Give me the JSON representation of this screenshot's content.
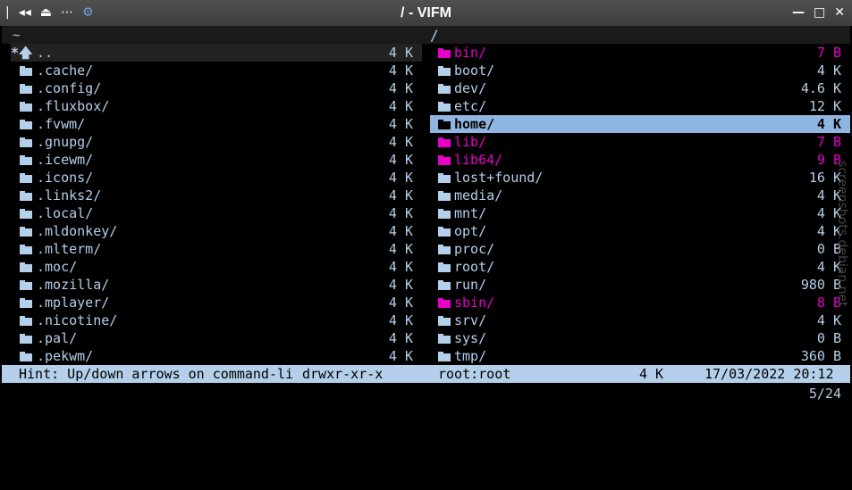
{
  "window": {
    "title": "/ - VIFM",
    "left_icons": [
      "|",
      "◂◂",
      "⏏",
      "⋯",
      "⚙"
    ],
    "controls": {
      "minimize": "—",
      "maximize": "□",
      "close": "✕"
    }
  },
  "paths": {
    "left": "~",
    "right": "/"
  },
  "left_pane": [
    {
      "name": "..",
      "size": "4 K"
    },
    {
      "name": ".cache/",
      "size": "4 K"
    },
    {
      "name": ".config/",
      "size": "4 K"
    },
    {
      "name": ".fluxbox/",
      "size": "4 K"
    },
    {
      "name": ".fvwm/",
      "size": "4 K"
    },
    {
      "name": ".gnupg/",
      "size": "4 K"
    },
    {
      "name": ".icewm/",
      "size": "4 K"
    },
    {
      "name": ".icons/",
      "size": "4 K"
    },
    {
      "name": ".links2/",
      "size": "4 K"
    },
    {
      "name": ".local/",
      "size": "4 K"
    },
    {
      "name": ".mldonkey/",
      "size": "4 K"
    },
    {
      "name": ".mlterm/",
      "size": "4 K"
    },
    {
      "name": ".moc/",
      "size": "4 K"
    },
    {
      "name": ".mozilla/",
      "size": "4 K"
    },
    {
      "name": ".mplayer/",
      "size": "4 K"
    },
    {
      "name": ".nicotine/",
      "size": "4 K"
    },
    {
      "name": ".pal/",
      "size": "4 K"
    },
    {
      "name": ".pekwm/",
      "size": "4 K"
    }
  ],
  "right_pane": [
    {
      "name": "bin/",
      "size": "7 B",
      "link": true
    },
    {
      "name": "boot/",
      "size": "4 K"
    },
    {
      "name": "dev/",
      "size": "4.6 K"
    },
    {
      "name": "etc/",
      "size": "12 K"
    },
    {
      "name": "home/",
      "size": "4 K",
      "selected": true
    },
    {
      "name": "lib/",
      "size": "7 B",
      "link": true
    },
    {
      "name": "lib64/",
      "size": "9 B",
      "link": true
    },
    {
      "name": "lost+found/",
      "size": "16 K"
    },
    {
      "name": "media/",
      "size": "4 K"
    },
    {
      "name": "mnt/",
      "size": "4 K"
    },
    {
      "name": "opt/",
      "size": "4 K"
    },
    {
      "name": "proc/",
      "size": "0 B"
    },
    {
      "name": "root/",
      "size": "4 K"
    },
    {
      "name": "run/",
      "size": "980 B"
    },
    {
      "name": "sbin/",
      "size": "8 B",
      "link": true
    },
    {
      "name": "srv/",
      "size": "4 K"
    },
    {
      "name": "sys/",
      "size": "0 B"
    },
    {
      "name": "tmp/",
      "size": "360 B"
    }
  ],
  "status": {
    "hint": "Hint: Up/down arrows on command-li",
    "permissions": "drwxr-xr-x",
    "owner": "root:root",
    "size": "4 K",
    "datetime": "17/03/2022 20:12"
  },
  "counter": "5/24",
  "watermark": "screenshots.debian.net",
  "colors": {
    "accent": "#8fb6e0",
    "text": "#b3cfe9",
    "link": "#e800c8",
    "background": "#000000"
  }
}
